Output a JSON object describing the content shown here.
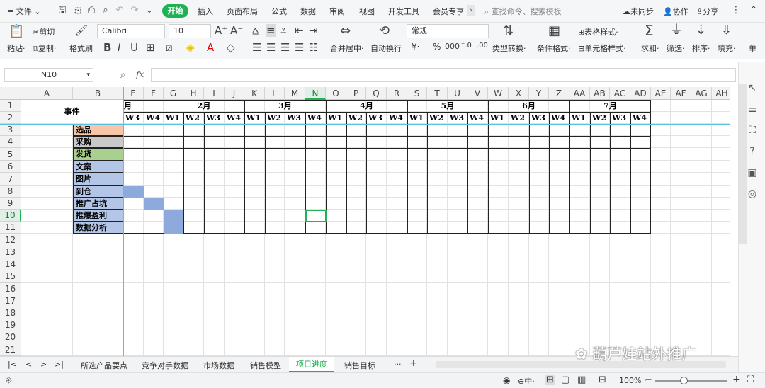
{
  "menu": {
    "file": "文件",
    "tabs": [
      "开始",
      "插入",
      "页面布局",
      "公式",
      "数据",
      "审阅",
      "视图",
      "开发工具",
      "会员专享"
    ],
    "search_placeholder": "查找命令、搜索模板",
    "sync": "未同步",
    "collab": "协作",
    "share": "分享"
  },
  "ribbon": {
    "paste": "粘贴",
    "cut": "剪切",
    "copy": "复制",
    "format_painter": "格式刷",
    "font_name": "Calibri",
    "font_size": "10",
    "merge_center": "合并居中",
    "auto_wrap": "自动换行",
    "number_format": "常规",
    "type_convert": "类型转换",
    "cond_format": "条件格式",
    "table_style": "表格样式",
    "cell_style": "单元格样式",
    "sum": "求和",
    "filter": "筛选",
    "sort": "排序",
    "fill": "填充",
    "single": "单"
  },
  "formula_bar": {
    "name_box": "N10",
    "fx": "fx",
    "value": ""
  },
  "columns": [
    "A",
    "B",
    "E",
    "F",
    "G",
    "H",
    "I",
    "J",
    "K",
    "L",
    "M",
    "N",
    "O",
    "P",
    "Q",
    "R",
    "S",
    "T",
    "U",
    "V",
    "W",
    "X",
    "Y",
    "Z",
    "AA",
    "AB",
    "AC",
    "AD",
    "AE",
    "AF",
    "AG",
    "AH"
  ],
  "rows": [
    "1",
    "2",
    "3",
    "4",
    "5",
    "6",
    "7",
    "8",
    "9",
    "10",
    "11",
    "12",
    "13",
    "14",
    "15",
    "16",
    "17",
    "18",
    "19",
    "20",
    "21"
  ],
  "sheet": {
    "event_header": "事件",
    "months": [
      "月",
      "2月",
      "3月",
      "4月",
      "5月",
      "6月",
      "7月"
    ],
    "weeks": [
      "W3",
      "W4",
      "W1",
      "W2",
      "W3",
      "W4",
      "W1",
      "W2",
      "W3",
      "W4",
      "W1",
      "W2",
      "W3",
      "W4",
      "W1",
      "W2",
      "W3",
      "W4",
      "W1",
      "W2",
      "W3",
      "W4",
      "W1",
      "W2",
      "W3",
      "W4"
    ],
    "tasks": [
      {
        "name": "选品",
        "color": "#f7c6a8"
      },
      {
        "name": "采购",
        "color": "#c9c9c9"
      },
      {
        "name": "发货",
        "color": "#a9d08e"
      },
      {
        "name": "文案",
        "color": "#b4c6e7"
      },
      {
        "name": "图片",
        "color": "#b4c6e7"
      },
      {
        "name": "到仓",
        "color": "#b4c6e7"
      },
      {
        "name": "推广占坑",
        "color": "#b4c6e7"
      },
      {
        "name": "推爆盈利",
        "color": "#b4c6e7"
      },
      {
        "name": "数据分析",
        "color": "#b4c6e7"
      }
    ],
    "gantt_fill_color": "#8ea9db"
  },
  "sheet_tabs": [
    "所选产品要点",
    "竞争对手数据",
    "市场数据",
    "销售模型",
    "项目进度",
    "销售目标"
  ],
  "active_sheet": "项目进度",
  "status": {
    "view_label": "中",
    "zoom": "100%"
  },
  "watermark": "葫芦娃站外推广"
}
